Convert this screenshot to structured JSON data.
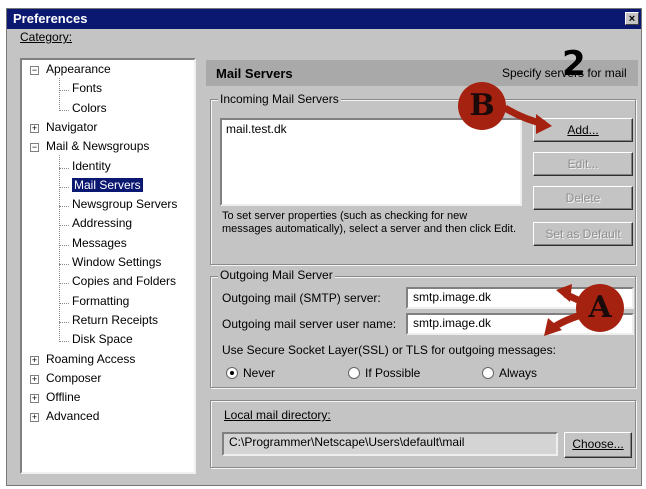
{
  "window": {
    "title": "Preferences",
    "close_glyph": "×"
  },
  "category_label": "Category:",
  "tree": [
    {
      "label": "Appearance",
      "expander": "−"
    },
    {
      "label": "Fonts"
    },
    {
      "label": "Colors"
    },
    {
      "label": "Navigator",
      "expander": "+"
    },
    {
      "label": "Mail & Newsgroups",
      "expander": "−"
    },
    {
      "label": "Identity"
    },
    {
      "label": "Mail Servers",
      "selected": true
    },
    {
      "label": "Newsgroup Servers"
    },
    {
      "label": "Addressing"
    },
    {
      "label": "Messages"
    },
    {
      "label": "Window Settings"
    },
    {
      "label": "Copies and Folders"
    },
    {
      "label": "Formatting"
    },
    {
      "label": "Return Receipts"
    },
    {
      "label": "Disk Space"
    },
    {
      "label": "Roaming Access",
      "expander": "+"
    },
    {
      "label": "Composer",
      "expander": "+"
    },
    {
      "label": "Offline",
      "expander": "+"
    },
    {
      "label": "Advanced",
      "expander": "+"
    }
  ],
  "panel": {
    "title": "Mail Servers",
    "subtitle": "Specify servers for mail"
  },
  "incoming": {
    "group_label": "Incoming Mail Servers",
    "servers": [
      "mail.test.dk"
    ],
    "add": "Add...",
    "edit": "Edit...",
    "delete": "Delete",
    "set_default": "Set as Default",
    "hint": "To set server properties (such as checking for new messages automatically), select a server and then click Edit."
  },
  "outgoing": {
    "group_label": "Outgoing Mail Server",
    "smtp_label": "Outgoing mail (SMTP) server:",
    "smtp_value": "smtp.image.dk",
    "user_label": "Outgoing mail server user name:",
    "user_value": "smtp.image.dk",
    "ssl_label": "Use Secure Socket Layer(SSL) or TLS for outgoing messages:",
    "radio_never": "Never",
    "radio_possible": "If Possible",
    "radio_always": "Always",
    "selected": "Never"
  },
  "local": {
    "label": "Local mail directory:",
    "path": "C:\\Programmer\\Netscape\\Users\\default\\mail",
    "choose": "Choose..."
  },
  "annotations": {
    "callout_b": "B",
    "callout_a": "A",
    "step_number": "2",
    "color": "#a62210"
  }
}
